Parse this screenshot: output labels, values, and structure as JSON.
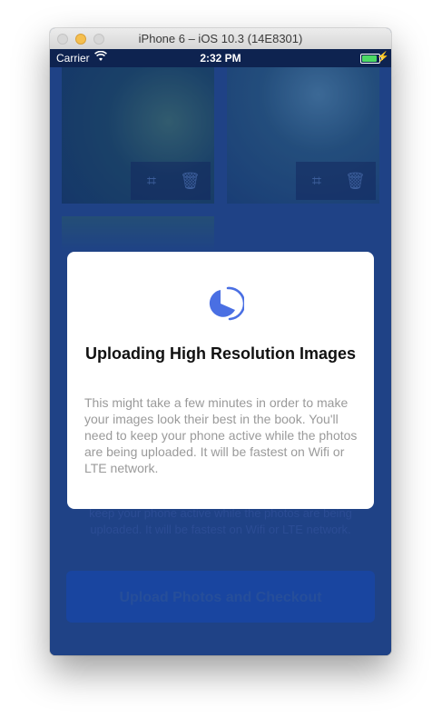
{
  "window": {
    "title": "iPhone 6 – iOS 10.3 (14E8301)"
  },
  "status_bar": {
    "carrier": "Carrier",
    "time": "2:32 PM",
    "battery_level": 1.0
  },
  "modal": {
    "title": "Uploading High Resolution Images",
    "body": "This might take a few minutes in order to make your images look their best in the book. You'll need to keep your phone active while the photos are being uploaded. It will be fastest on Wifi or LTE network."
  },
  "background": {
    "note": "Uploading your photos may take a while. You'll need to keep your phone active while the photos are being uploaded. It will be fastest on Wifi or LTE network.",
    "button_label": "Upload Photos and Checkout"
  },
  "icons": {
    "crop": "crop-icon",
    "trash": "trash-icon",
    "wifi": "wifi-icon",
    "upload": "upload-progress-icon"
  },
  "colors": {
    "accent": "#4a6fe3",
    "background": "#244b8e",
    "battery": "#4cd964"
  }
}
